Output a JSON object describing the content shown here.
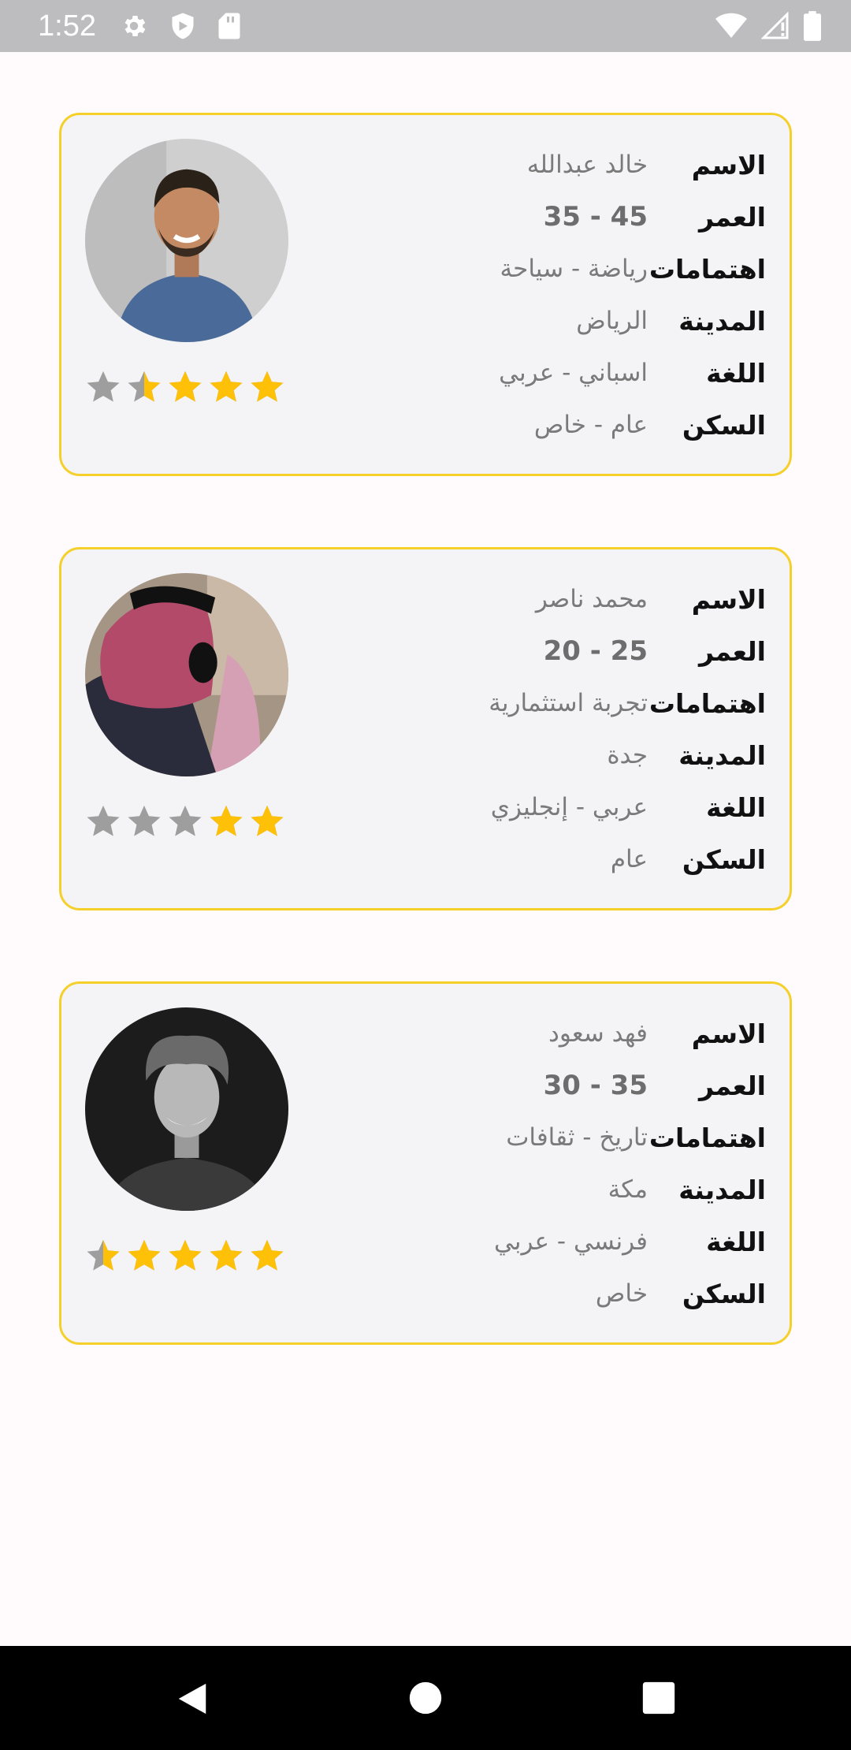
{
  "status_bar": {
    "time": "1:52",
    "icons_left": [
      "gear-icon",
      "shield-icon",
      "sd-card-icon"
    ],
    "icons_right": [
      "wifi-icon",
      "signal-icon",
      "battery-icon"
    ]
  },
  "labels": {
    "name": "الاسم",
    "age": "العمر",
    "interests": "اهتمامات",
    "city": "المدينة",
    "language": "اللغة",
    "housing": "السكن"
  },
  "profiles": [
    {
      "name": "خالد عبدالله",
      "age": "35 - 45",
      "interests": "رياضة - سياحة",
      "city": "الرياض",
      "language": "اسباني - عربي",
      "housing": "عام - خاص",
      "rating": 3.5,
      "max_rating": 5
    },
    {
      "name": "محمد ناصر",
      "age": "20 - 25",
      "interests": "تجربة استثمارية",
      "city": "جدة",
      "language": "عربي - إنجليزي",
      "housing": "عام",
      "rating": 2,
      "max_rating": 5
    },
    {
      "name": "فهد سعود",
      "age": "30 - 35",
      "interests": "تاريخ - ثقافات",
      "city": "مكة",
      "language": "فرنسي - عربي",
      "housing": "خاص",
      "rating": 4.5,
      "max_rating": 5
    }
  ],
  "colors": {
    "star_filled": "#fec107",
    "star_empty": "#9e9e9e",
    "card_border": "#f5cf2a",
    "card_bg": "#f4f3f5"
  },
  "nav_bar": {
    "icons": [
      "back-icon",
      "home-icon",
      "recents-icon"
    ]
  }
}
